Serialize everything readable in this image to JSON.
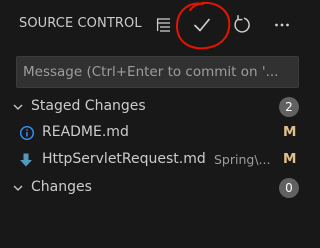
{
  "header": {
    "title": "SOURCE CONTROL",
    "actions": [
      {
        "name": "view-as-tree",
        "icon": "list-tree-icon"
      },
      {
        "name": "commit",
        "icon": "check-icon"
      },
      {
        "name": "refresh",
        "icon": "refresh-icon"
      },
      {
        "name": "more-actions",
        "icon": "ellipsis-icon"
      }
    ]
  },
  "commit_message": {
    "placeholder": "Message (Ctrl+Enter to commit on '...",
    "value": ""
  },
  "groups": [
    {
      "label": "Staged Changes",
      "count": "2",
      "expanded": true,
      "files": [
        {
          "name": "README.md",
          "description": "",
          "status": "M",
          "icon": "info-icon"
        },
        {
          "name": "HttpServletRequest.md",
          "description": "Spring\\...",
          "status": "M",
          "icon": "download-arrow-icon"
        }
      ]
    },
    {
      "label": "Changes",
      "count": "0",
      "expanded": true,
      "files": []
    }
  ],
  "colors": {
    "background": "#181818",
    "text": "#cccccc",
    "modified_status": "#e2c08d",
    "badge": "#616161",
    "info_icon": "#3794ff",
    "file_icon_blue": "#519aba",
    "annotation": "#e51400"
  }
}
